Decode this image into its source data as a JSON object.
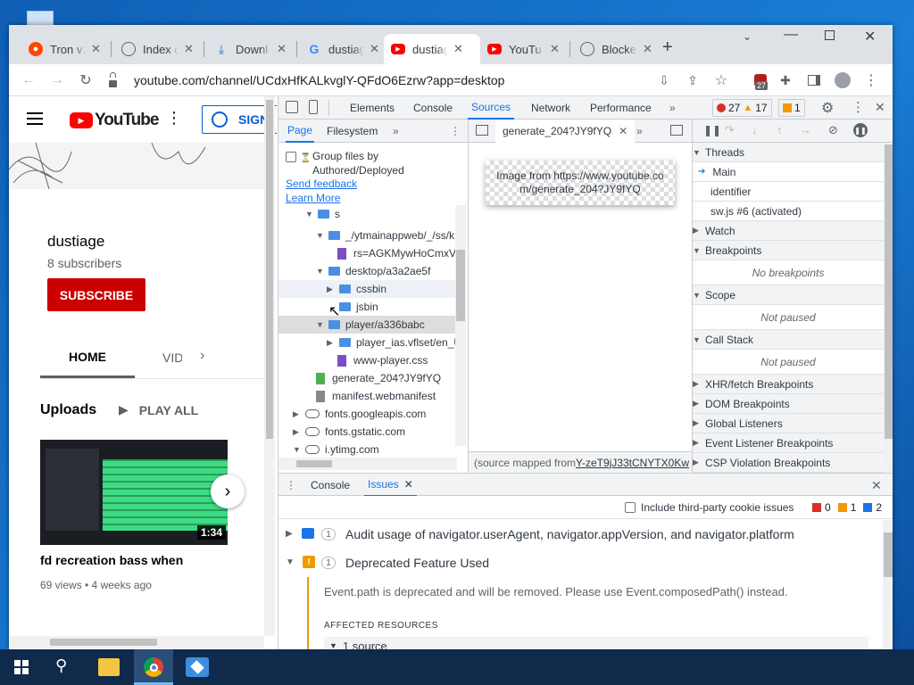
{
  "tabs": [
    {
      "title": "Tron v1",
      "color": "#ff4500",
      "icon": "reddit-icon"
    },
    {
      "title": "Index o",
      "color": "#5f6368",
      "icon": "globe-icon"
    },
    {
      "title": "Downl",
      "color": "#1a73e8",
      "icon": "download-icon"
    },
    {
      "title": "dustiag",
      "color": "#4285f4",
      "icon": "google-icon"
    },
    {
      "title": "dustiag",
      "color": "#ff0000",
      "icon": "youtube-icon",
      "active": true
    },
    {
      "title": "YouTu",
      "color": "#ff0000",
      "icon": "youtube-icon"
    },
    {
      "title": "Blocke",
      "color": "#5f6368",
      "icon": "globe-icon"
    }
  ],
  "url": "youtube.com/channel/UCdxHfKALkvglY-QFdO6Ezrw?app=desktop",
  "ext_badge": "27",
  "youtube": {
    "sign_in": "SIGN",
    "channel_name": "dustiage",
    "subscribers": "8 subscribers",
    "subscribe": "SUBSCRIBE",
    "tab_home": "HOME",
    "tab_videos": "VID",
    "uploads": "Uploads",
    "play_all": "PLAY ALL",
    "video_title": "fd recreation bass when",
    "video_meta": "69 views • 4 weeks ago",
    "duration": "1:34"
  },
  "devtools": {
    "tabs": [
      "Elements",
      "Console",
      "Sources",
      "Network",
      "Performance"
    ],
    "errors": "27",
    "warnings": "17",
    "issues": "1",
    "nav_tabs": {
      "page": "Page",
      "filesystem": "Filesystem"
    },
    "group_label": "Group files by Authored/Deployed",
    "send_feedback": "Send feedback",
    "learn_more": "Learn More",
    "tree": [
      {
        "label": "s",
        "type": "folder",
        "arrow": "▼",
        "depth": 1
      },
      {
        "label": "_/ytmainappweb/_/ss/k",
        "type": "folder",
        "arrow": "▼",
        "depth": 2
      },
      {
        "label": "rs=AGKMywHoCmxV",
        "type": "file-purple",
        "depth": 3
      },
      {
        "label": "desktop/a3a2ae5f",
        "type": "folder",
        "arrow": "▼",
        "depth": 2
      },
      {
        "label": "cssbin",
        "type": "folder",
        "arrow": "▶",
        "depth": 3
      },
      {
        "label": "jsbin",
        "type": "folder",
        "depth": 3
      },
      {
        "label": "player/a336babc",
        "type": "folder",
        "arrow": "▼",
        "depth": 2
      },
      {
        "label": "player_ias.vflset/en_U",
        "type": "folder",
        "arrow": "▶",
        "depth": 3
      },
      {
        "label": "www-player.css",
        "type": "file-purple",
        "depth": 3
      },
      {
        "label": "generate_204?JY9fYQ",
        "type": "file-green",
        "depth": 2
      },
      {
        "label": "manifest.webmanifest",
        "type": "file-gray",
        "depth": 2
      },
      {
        "label": "fonts.googleapis.com",
        "type": "cloud",
        "arrow": "▶",
        "depth": 1
      },
      {
        "label": "fonts.gstatic.com",
        "type": "cloud",
        "arrow": "▶",
        "depth": 1
      },
      {
        "label": "i.ytimg.com",
        "type": "cloud",
        "arrow": "▼",
        "depth": 1
      }
    ],
    "editor_tab": "generate_204?JY9fYQ",
    "image_alt": "Image from https://www.youtube.com/generate_204?JY9fYQ",
    "source_mapped": "(source mapped from ",
    "source_mapped_link": "Y-zeT9jJ33tCNYTX0Kw",
    "threads": "Threads",
    "thread_main": "Main",
    "thread_identifier": "identifier",
    "thread_sw": "sw.js #6 (activated)",
    "watch": "Watch",
    "breakpoints": "Breakpoints",
    "no_breakpoints": "No breakpoints",
    "scope": "Scope",
    "not_paused": "Not paused",
    "call_stack": "Call Stack",
    "xhr": "XHR/fetch Breakpoints",
    "dom": "DOM Breakpoints",
    "global": "Global Listeners",
    "event_listener": "Event Listener Breakpoints",
    "csp": "CSP Violation Breakpoints",
    "drawer_console": "Console",
    "drawer_issues": "Issues",
    "third_party": "Include third-party cookie issues",
    "cnt_err": "0",
    "cnt_warn": "1",
    "cnt_info": "2",
    "issue1_count": "1",
    "issue1": "Audit usage of navigator.userAgent, navigator.appVersion, and navigator.platform",
    "issue2_count": "1",
    "issue2": "Deprecated Feature Used",
    "issue2_detail": "Event.path is deprecated and will be removed. Please use Event.composedPath() instead.",
    "affected": "AFFECTED RESOURCES",
    "one_source": "1 source"
  },
  "colors": {
    "accent": "#1a73e8",
    "youtube_red": "#cc0000",
    "error": "#d93025",
    "warning": "#f29900"
  }
}
